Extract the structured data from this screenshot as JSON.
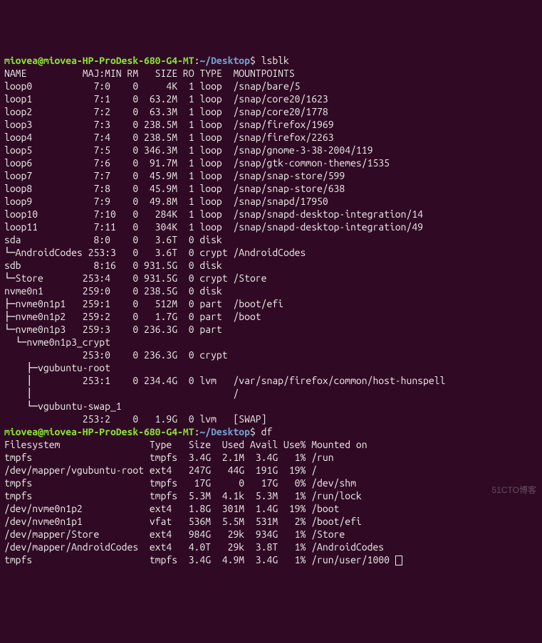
{
  "prompt1": {
    "user_host": "miovea@miovea-HP-ProDesk-680-G4-MT",
    "sep": ":",
    "path": "~/Desktop",
    "dollar": "$ ",
    "cmd": "lsblk"
  },
  "lsblk_header": "NAME          MAJ:MIN RM   SIZE RO TYPE  MOUNTPOINTS",
  "lsblk_rows": [
    "loop0           7:0    0     4K  1 loop  /snap/bare/5",
    "loop1           7:1    0  63.2M  1 loop  /snap/core20/1623",
    "loop2           7:2    0  63.3M  1 loop  /snap/core20/1778",
    "loop3           7:3    0 238.5M  1 loop  /snap/firefox/1969",
    "loop4           7:4    0 238.5M  1 loop  /snap/firefox/2263",
    "loop5           7:5    0 346.3M  1 loop  /snap/gnome-3-38-2004/119",
    "loop6           7:6    0  91.7M  1 loop  /snap/gtk-common-themes/1535",
    "loop7           7:7    0  45.9M  1 loop  /snap/snap-store/599",
    "loop8           7:8    0  45.9M  1 loop  /snap/snap-store/638",
    "loop9           7:9    0  49.8M  1 loop  /snap/snapd/17950",
    "loop10          7:10   0   284K  1 loop  /snap/snapd-desktop-integration/14",
    "loop11          7:11   0   304K  1 loop  /snap/snapd-desktop-integration/49",
    "sda             8:0    0   3.6T  0 disk",
    "└─AndroidCodes 253:3   0   3.6T  0 crypt /AndroidCodes",
    "sdb             8:16   0 931.5G  0 disk",
    "└─Store       253:4    0 931.5G  0 crypt /Store",
    "nvme0n1       259:0    0 238.5G  0 disk",
    "├─nvme0n1p1   259:1    0   512M  0 part  /boot/efi",
    "├─nvme0n1p2   259:2    0   1.7G  0 part  /boot",
    "└─nvme0n1p3   259:3    0 236.3G  0 part",
    "  └─nvme0n1p3_crypt",
    "              253:0    0 236.3G  0 crypt",
    "    ├─vgubuntu-root",
    "    │         253:1    0 234.4G  0 lvm   /var/snap/firefox/common/host-hunspell",
    "    │                                    /",
    "    └─vgubuntu-swap_1",
    "              253:2    0   1.9G  0 lvm   [SWAP]"
  ],
  "prompt2": {
    "user_host": "miovea@miovea-HP-ProDesk-680-G4-MT",
    "sep": ":",
    "path": "~/Desktop",
    "dollar": "$ ",
    "cmd": "df"
  },
  "df_header": "Filesystem                Type   Size  Used Avail Use% Mounted on",
  "df_rows": [
    "tmpfs                     tmpfs  3.4G  2.1M  3.4G   1% /run",
    "/dev/mapper/vgubuntu-root ext4   247G   44G  191G  19% /",
    "tmpfs                     tmpfs   17G     0   17G   0% /dev/shm",
    "tmpfs                     tmpfs  5.3M  4.1k  5.3M   1% /run/lock",
    "/dev/nvme0n1p2            ext4   1.8G  301M  1.4G  19% /boot",
    "/dev/nvme0n1p1            vfat   536M  5.5M  531M   2% /boot/efi",
    "/dev/mapper/Store         ext4   984G   29k  934G   1% /Store",
    "/dev/mapper/AndroidCodes  ext4   4.0T   29k  3.8T   1% /AndroidCodes",
    "tmpfs                     tmpfs  3.4G  4.9M  3.4G   1% /run/user/1000"
  ],
  "watermark": "51CTO博客"
}
